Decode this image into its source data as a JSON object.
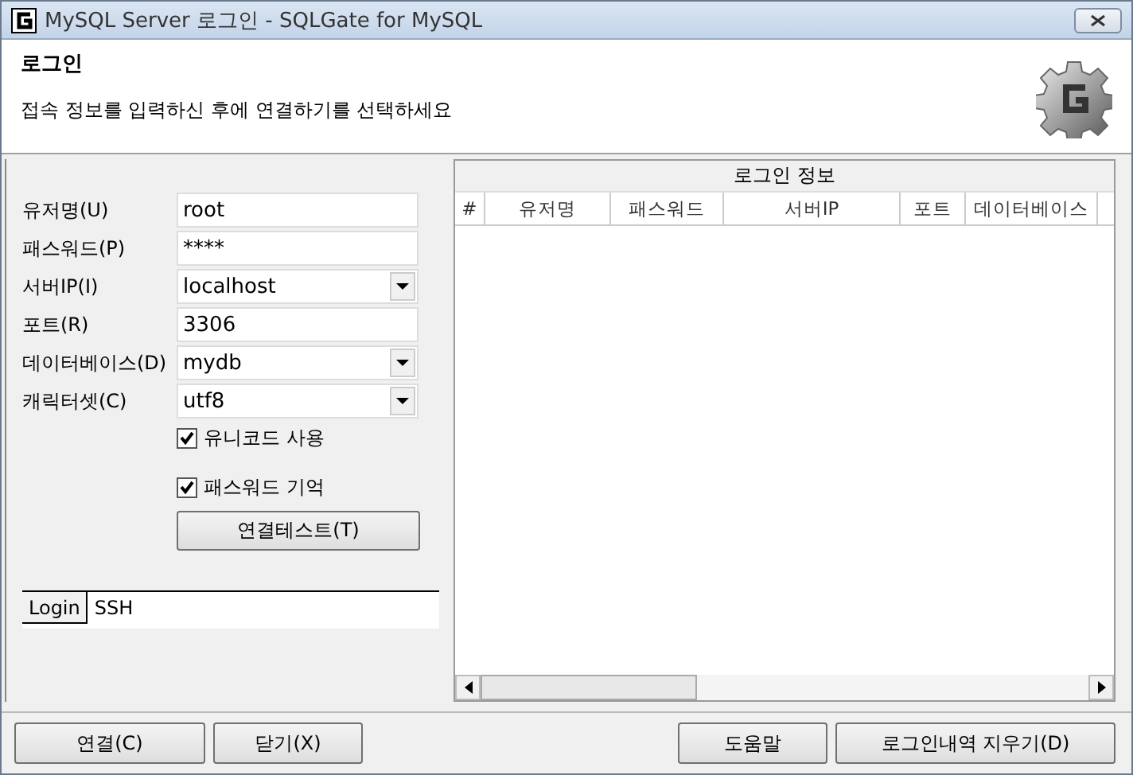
{
  "window": {
    "title": "MySQL Server 로그인  - SQLGate for MySQL"
  },
  "header": {
    "title": "로그인",
    "description": "접속 정보를 입력하신 후에 연결하기를 선택하세요"
  },
  "fields": [
    {
      "label": "유저명(U)",
      "value": "root",
      "kind": "text"
    },
    {
      "label": "패스워드(P)",
      "value": "****",
      "kind": "text"
    },
    {
      "label": "서버IP(I)",
      "value": "localhost",
      "kind": "combo"
    },
    {
      "label": "포트(R)",
      "value": "3306",
      "kind": "text"
    },
    {
      "label": "데이터베이스(D)",
      "value": "mydb",
      "kind": "combo"
    },
    {
      "label": "캐릭터셋(C)",
      "value": "utf8",
      "kind": "combo"
    }
  ],
  "checkboxes": [
    {
      "label": "유니코드 사용",
      "checked": true
    },
    {
      "label": "패스워드 기억",
      "checked": true
    }
  ],
  "test_button": "연결테스트(T)",
  "tabs": [
    {
      "label": "Login",
      "selected": true
    },
    {
      "label": "SSH",
      "selected": false
    }
  ],
  "history": {
    "title": "로그인 정보",
    "columns": [
      "#",
      "유저명",
      "패스워드",
      "서버IP",
      "포트",
      "데이터베이스"
    ]
  },
  "buttons_left": [
    "연결(C)",
    "닫기(X)"
  ],
  "buttons_right": [
    "도움말",
    "로그인내역 지우기(D)"
  ]
}
